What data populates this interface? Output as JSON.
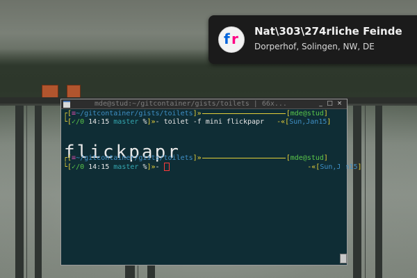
{
  "notification": {
    "title": "Nat\\303\\274rliche Feinde",
    "body": "Dorperhof, Solingen, NW, DE",
    "icon": "flickr-icon",
    "icon_letters": [
      "f",
      "r"
    ]
  },
  "terminal": {
    "title": "mde@stud:~/gitcontainer/gists/toilets | 66x...",
    "prompt1": {
      "path": "~/gitcontainer/gists/toilets",
      "user": "mde@stud",
      "status": "✓/0",
      "time": "14:15",
      "branch": "master",
      "branch_mark": "%",
      "command": "toilet -f mini flickpapr",
      "date": "Sun,Jan15"
    },
    "banner": " |̅ |̅ ck̅p̅a̅p̅r̅",
    "banner_text": "flickpapr",
    "prompt2": {
      "path": "~/gitcontainer/gists/toilets",
      "user": "mde@stud",
      "status": "✓/0",
      "time": "14:15",
      "branch": "master",
      "branch_mark": "%",
      "date": "Sun,Jan15"
    }
  },
  "colors": {
    "prompt_yellow": "#e5cf39",
    "prompt_green": "#5ac64a",
    "prompt_blue": "#3f8fc5",
    "terminal_bg": "#0f2d35"
  }
}
